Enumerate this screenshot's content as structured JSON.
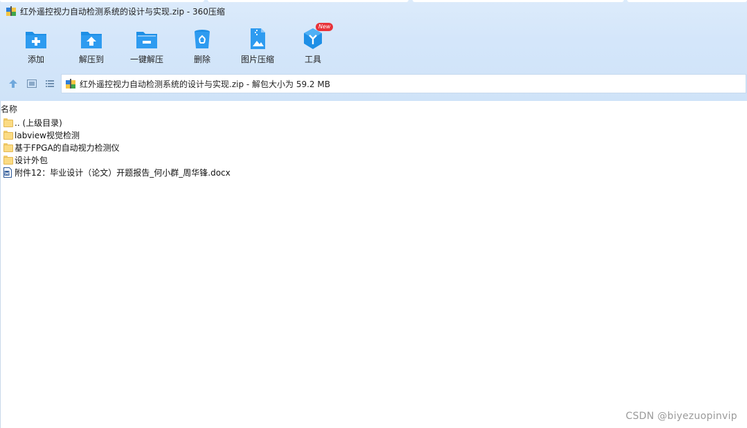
{
  "window": {
    "title": "红外遥控视力自动检测系统的设计与实现.zip - 360压缩"
  },
  "toolbar": {
    "items": [
      {
        "label": "添加",
        "icon": "add-folder-icon"
      },
      {
        "label": "解压到",
        "icon": "extract-to-icon"
      },
      {
        "label": "一键解压",
        "icon": "one-click-extract-icon"
      },
      {
        "label": "删除",
        "icon": "recycle-bin-icon"
      },
      {
        "label": "图片压缩",
        "icon": "image-compress-icon"
      },
      {
        "label": "工具",
        "icon": "tools-cube-icon"
      }
    ],
    "new_badge": "New"
  },
  "address": {
    "text": "红外遥控视力自动检测系统的设计与实现.zip - 解包大小为 59.2 MB"
  },
  "list": {
    "column_name": "名称",
    "rows": [
      {
        "name": ".. (上级目录)",
        "type": "folder"
      },
      {
        "name": "labview视觉检测",
        "type": "folder"
      },
      {
        "name": "基于FPGA的自动视力检测仪",
        "type": "folder"
      },
      {
        "name": "设计外包",
        "type": "folder"
      },
      {
        "name": "附件12：毕业设计（论文）开题报告_何小群_周华锋.docx",
        "type": "docx"
      }
    ]
  },
  "watermark": "CSDN @biyezuopinvip",
  "colors": {
    "accent": "#1e8fe6",
    "chrome_bg": "#d4e6fa",
    "folder": "#fbdb83",
    "badge": "#e8333a"
  }
}
